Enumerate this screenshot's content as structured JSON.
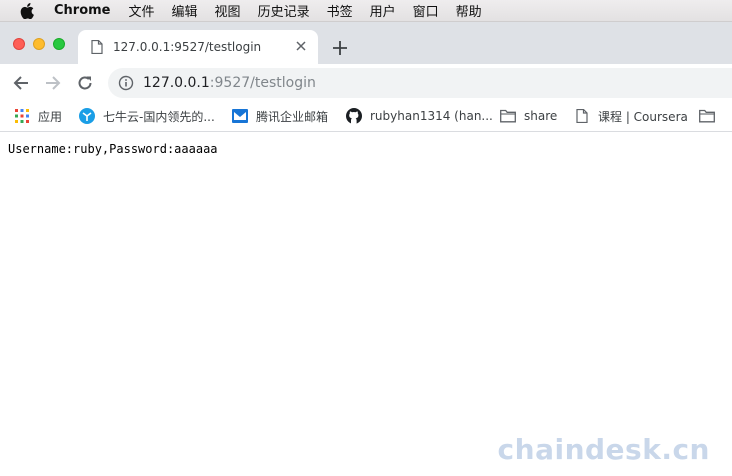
{
  "menubar": {
    "app_name": "Chrome",
    "items": [
      "文件",
      "编辑",
      "视图",
      "历史记录",
      "书签",
      "用户",
      "窗口",
      "帮助"
    ]
  },
  "tab": {
    "title": "127.0.0.1:9527/testlogin"
  },
  "address_bar": {
    "host": "127.0.0.1",
    "rest": ":9527/testlogin"
  },
  "bookmarks": [
    {
      "label": "应用",
      "icon": "apps-grid-icon"
    },
    {
      "label": "七牛云-国内领先的...",
      "icon": "qiniu-icon"
    },
    {
      "label": "腾讯企业邮箱",
      "icon": "tencent-mail-icon"
    },
    {
      "label": "rubyhan1314 (han...",
      "icon": "github-icon"
    },
    {
      "label": "share",
      "icon": "folder-icon"
    },
    {
      "label": "课程 | Coursera",
      "icon": "page-icon"
    },
    {
      "label": "",
      "icon": "folder-icon"
    }
  ],
  "page": {
    "text": "Username:ruby,Password:aaaaaa"
  },
  "watermark": "chaindesk.cn",
  "colors": {
    "tabstrip": "#dee1e6",
    "omnibox": "#f1f3f4",
    "close_red": "#fe5f57",
    "minimize_yellow": "#febc2e",
    "zoom_green": "#28c840"
  }
}
